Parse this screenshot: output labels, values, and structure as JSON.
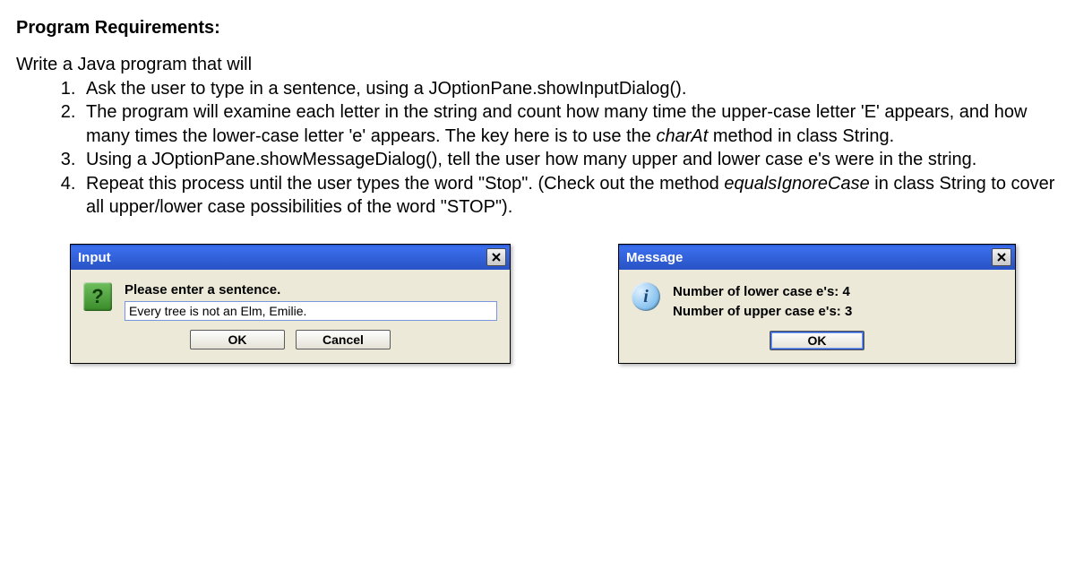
{
  "heading": "Program Requirements:",
  "intro": "Write a Java program that will",
  "items": {
    "i1a": "Ask the user to type in a sentence, using a JOptionPane.showInputDialog().",
    "i2a": "The program will examine each letter in the string and count how many time the upper-case letter 'E' appears, and how many times the lower-case letter 'e' appears. The key here is to use the ",
    "i2b": "charAt",
    "i2c": " method in class String.",
    "i3a": "Using a JOptionPane.showMessageDialog(), tell the user how many upper and lower case e's were in the string.",
    "i4a": "Repeat this process until the user types the word \"Stop\". (Check out the method ",
    "i4b": "equalsIgnoreCase",
    "i4c": " in class String to cover all upper/lower case possibilities of the word \"STOP\")."
  },
  "inputDialog": {
    "title": "Input",
    "prompt": "Please enter a sentence.",
    "value": "Every tree is not an Elm, Emilie.",
    "ok": "OK",
    "cancel": "Cancel"
  },
  "messageDialog": {
    "title": "Message",
    "line1": "Number of lower case e's: 4",
    "line2": "Number of upper case e's: 3",
    "ok": "OK"
  }
}
